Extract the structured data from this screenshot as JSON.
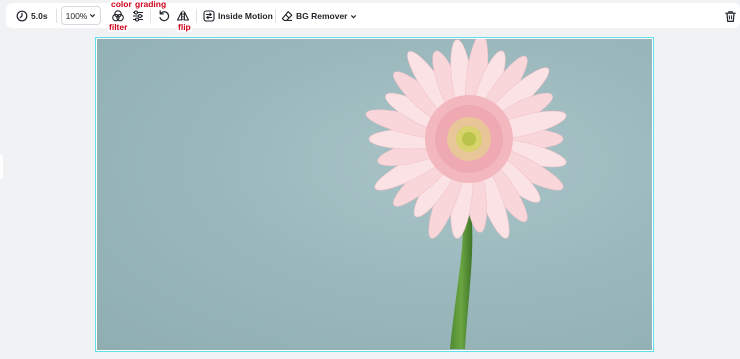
{
  "toolbar": {
    "duration_label": "5.0s",
    "zoom_label": "100%",
    "inside_motion_label": "Inside Motion",
    "bg_remover_label": "BG Remover"
  },
  "annotations": {
    "color": "color",
    "grading": "grading",
    "filter": "filter",
    "flip": "flip"
  },
  "icons": {
    "duration": "clock-icon",
    "zoom": "chevron-down-icon",
    "filter": "filter-icon",
    "grading": "sliders-icon",
    "rotate": "rotate-icon",
    "flip": "flip-icon",
    "inside_motion": "motion-icon",
    "bg_remover": "eraser-icon",
    "delete": "trash-icon"
  },
  "colors": {
    "selection_border": "#5fe0ec",
    "annotation_text": "#d0021b",
    "photo_background": "#9bb9bd"
  }
}
